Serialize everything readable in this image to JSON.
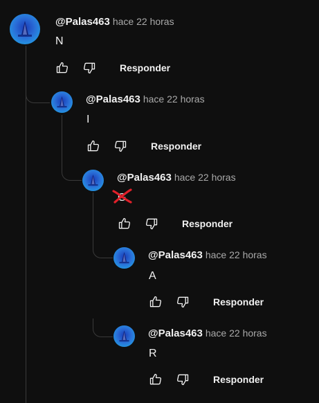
{
  "comments": [
    {
      "author": "@Palas463",
      "time": "hace 22 horas",
      "text": "N",
      "like_icon": "thumbs-up-icon",
      "dislike_icon": "thumbs-down-icon",
      "reply_label": "Responder"
    },
    {
      "author": "@Palas463",
      "time": "hace 22 horas",
      "text": "I",
      "like_icon": "thumbs-up-icon",
      "dislike_icon": "thumbs-down-icon",
      "reply_label": "Responder"
    },
    {
      "author": "@Palas463",
      "time": "hace 22 horas",
      "text": "G",
      "like_icon": "thumbs-up-icon",
      "dislike_icon": "thumbs-down-icon",
      "reply_label": "Responder",
      "struck_through": true,
      "strike_color": "#e0202a"
    },
    {
      "author": "@Palas463",
      "time": "hace 22 horas",
      "text": "A",
      "like_icon": "thumbs-up-icon",
      "dislike_icon": "thumbs-down-icon",
      "reply_label": "Responder"
    },
    {
      "author": "@Palas463",
      "time": "hace 22 horas",
      "text": "R",
      "like_icon": "thumbs-up-icon",
      "dislike_icon": "thumbs-down-icon",
      "reply_label": "Responder"
    }
  ],
  "colors": {
    "background": "#0f0f0f",
    "thread_line": "#3a3a3a",
    "text": "#f1f1f1",
    "muted": "#aaaaaa"
  }
}
